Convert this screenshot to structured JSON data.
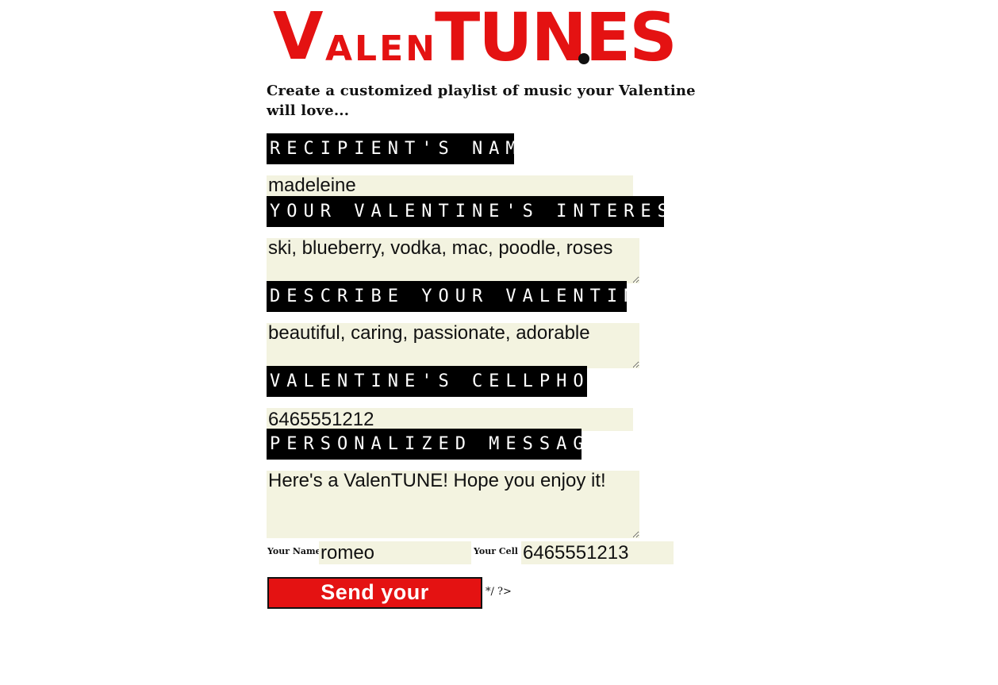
{
  "brand": {
    "logo_part1": "V",
    "logo_part2": "ALEN",
    "logo_part3": "TUNES",
    "logo_alt": "ValenTUNES",
    "color": "#e41212"
  },
  "intro": " Create a customized playlist of music your Valentine will love...",
  "form": {
    "recipient": {
      "label": "Recipient's Name:",
      "value": "madeleine"
    },
    "interests": {
      "label": "Your Valentine's Interests:",
      "value": "ski, blueberry, vodka, mac, poodle, roses"
    },
    "describe": {
      "label": "Describe Your Valentine:",
      "value": "beautiful, caring, passionate, adorable"
    },
    "cellphone": {
      "label": "Valentine's Cellphone:",
      "value": "6465551212"
    },
    "message": {
      "label": "Personalized Message:",
      "value": "Here's a ValenTUNE! Hope you enjoy it!"
    },
    "your_name": {
      "label": "Your Name",
      "value": "romeo"
    },
    "your_cell": {
      "label": "Your Cell",
      "value": "6465551213"
    },
    "submit_label": "Send your ValenTUNE",
    "trailing_text": "*/ ?>"
  }
}
